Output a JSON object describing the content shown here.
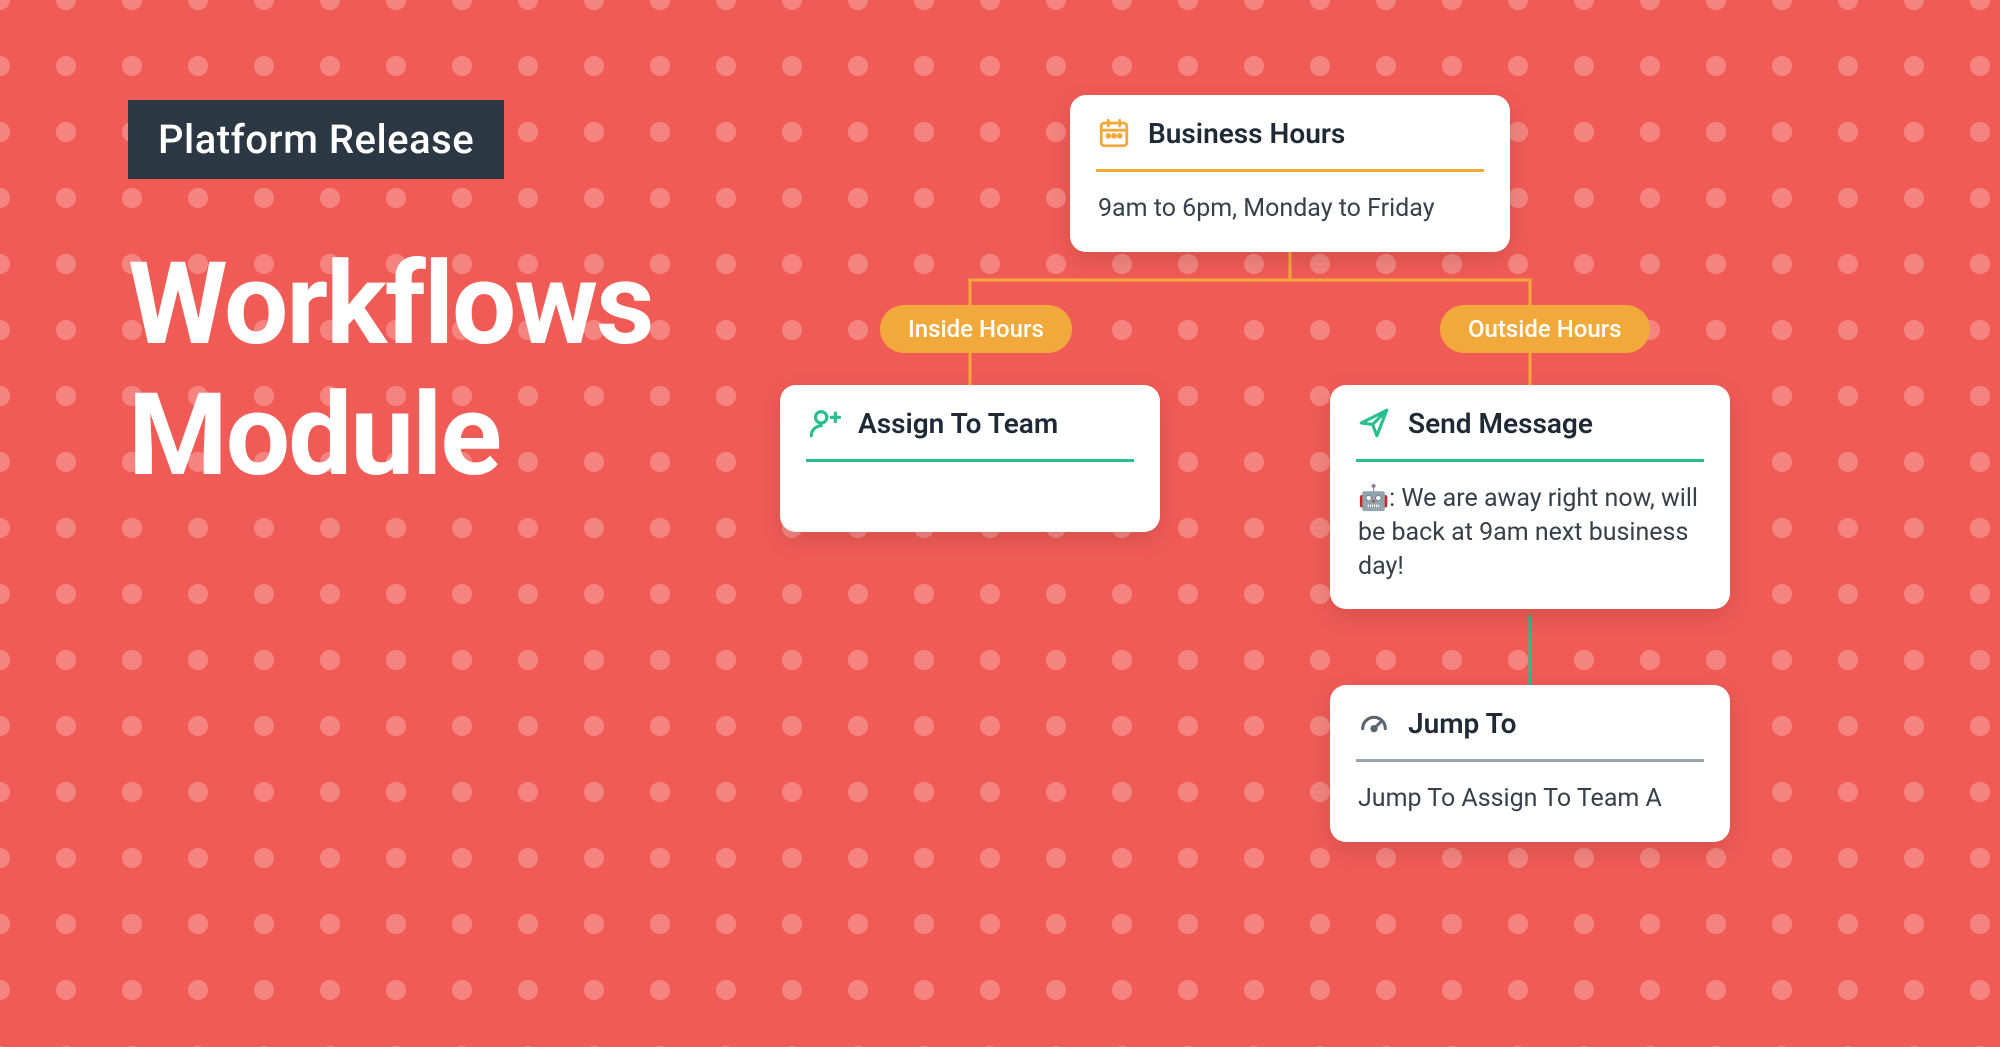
{
  "header": {
    "tag_label": "Platform Release",
    "title_line1": "Workflows",
    "title_line2": "Module"
  },
  "colors": {
    "bg": "#f15b56",
    "orange": "#f2a93b",
    "green": "#27c08a",
    "grey": "#9aa3ab",
    "dark": "#2b3743"
  },
  "branches": {
    "inside_label": "Inside Hours",
    "outside_label": "Outside Hours"
  },
  "nodes": {
    "business": {
      "title": "Business Hours",
      "body": "9am to 6pm, Monday to Friday",
      "icon_name": "calendar-icon",
      "divider_color": "#f2a93b"
    },
    "assign": {
      "title": "Assign To Team",
      "icon_name": "user-plus-icon",
      "divider_color": "#27c08a"
    },
    "send": {
      "title": "Send Message",
      "body": "🤖: We are away right now, will be back at 9am next business day!",
      "icon_name": "send-icon",
      "divider_color": "#27c08a"
    },
    "jump": {
      "title": "Jump To",
      "body": "Jump To Assign To Team A",
      "icon_name": "gauge-icon",
      "divider_color": "#9aa3ab"
    }
  }
}
